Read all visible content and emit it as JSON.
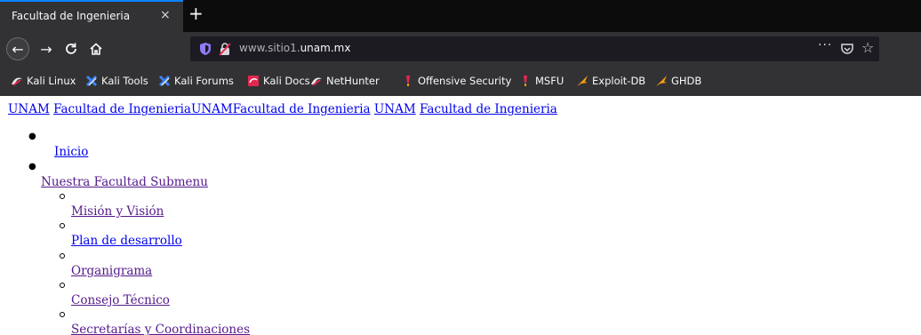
{
  "browser": {
    "tab": {
      "title": "Facultad de Ingenieria",
      "close_glyph": "×"
    },
    "new_tab_glyph": "+",
    "nav": {
      "back_glyph": "←",
      "forward_glyph": "→",
      "reload_glyph": "C",
      "home_glyph": "⌂"
    },
    "url": {
      "prefix": "www.sitio1.",
      "domain": "unam.mx",
      "more_glyph": "···",
      "star_glyph": "☆"
    },
    "bookmarks": [
      {
        "label": "Kali Linux",
        "icon": "kali-dragon-icon"
      },
      {
        "label": "Kali Tools",
        "icon": "kali-tools-icon"
      },
      {
        "label": "Kali Forums",
        "icon": "kali-forums-icon"
      },
      {
        "label": "Kali Docs",
        "icon": "kali-docs-icon"
      },
      {
        "label": "NetHunter",
        "icon": "nethunter-icon"
      },
      {
        "label": "Offensive Security",
        "icon": "offsec-icon"
      },
      {
        "label": "MSFU",
        "icon": "msfu-icon"
      },
      {
        "label": "Exploit-DB",
        "icon": "exploit-db-icon"
      },
      {
        "label": "GHDB",
        "icon": "ghdb-icon"
      }
    ]
  },
  "page": {
    "top_links": [
      "UNAM",
      "Facultad de Ingenieria",
      "UNAM",
      "Facultad de Ingenieria",
      "UNAM",
      "Facultad de Ingenieria"
    ],
    "menu": {
      "inicio": "Inicio",
      "nuestra_facultad": "Nuestra Facultad Submenu",
      "submenu": [
        "Misión y Visión",
        "Plan de desarrollo",
        "Organigrama",
        "Consejo Técnico",
        "Secretarías y Coordinaciones"
      ]
    }
  },
  "colors": {
    "link": "#0000ee",
    "visited": "#551a8b",
    "chrome_dark": "#323234",
    "tab_accent": "#0a84ff"
  }
}
